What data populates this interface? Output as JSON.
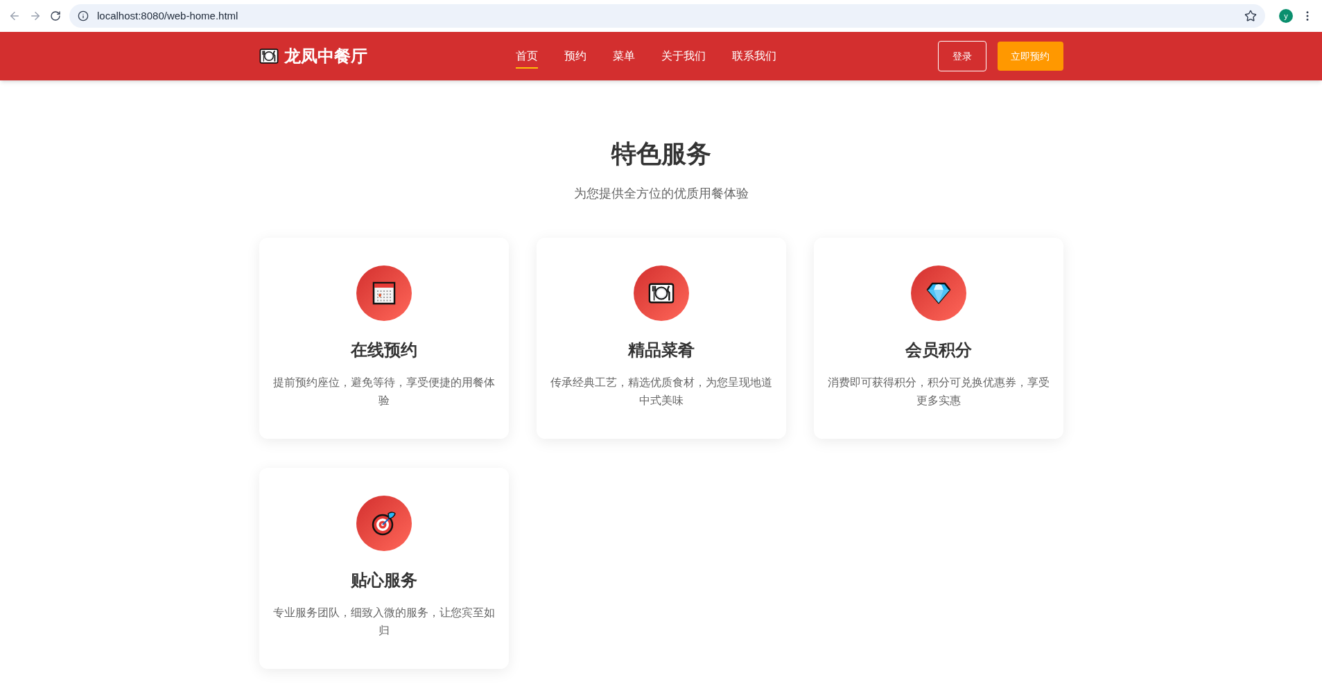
{
  "browser": {
    "url": "localhost:8080/web-home.html",
    "profile_initial": "y"
  },
  "header": {
    "logo": "龙凤中餐厅",
    "nav": [
      {
        "label": "首页",
        "selected": true
      },
      {
        "label": "预约",
        "selected": false
      },
      {
        "label": "菜单",
        "selected": false
      },
      {
        "label": "关于我们",
        "selected": false
      },
      {
        "label": "联系我们",
        "selected": false
      }
    ],
    "login_button": "登录",
    "reserve_button": "立即预约"
  },
  "section": {
    "title": "特色服务",
    "subtitle": "为您提供全方位的优质用餐体验",
    "cards": [
      {
        "kind": "calendar",
        "title": "在线预约",
        "description": "提前预约座位，避免等待，享受便捷的用餐体验"
      },
      {
        "kind": "dining",
        "title": "精品菜肴",
        "description": "传承经典工艺，精选优质食材，为您呈现地道中式美味"
      },
      {
        "kind": "diamond",
        "title": "会员积分",
        "description": "消费即可获得积分，积分可兑换优惠券，享受更多实惠"
      },
      {
        "kind": "target",
        "title": "贴心服务",
        "description": "专业服务团队，细致入微的服务，让您宾至如归"
      }
    ]
  }
}
